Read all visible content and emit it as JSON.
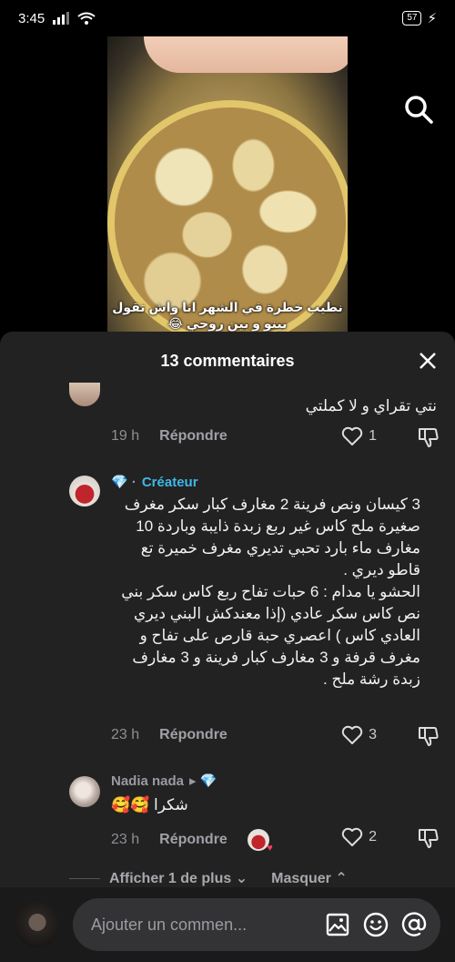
{
  "status_bar": {
    "time": "3:45",
    "battery": "57"
  },
  "video": {
    "caption": "نطيب خطرة في الشهر انا واش تقول بينو و بين روحي 😂"
  },
  "comments_sheet": {
    "title": "13 commentaires",
    "comments": [
      {
        "text": "نتي تقراي و لا كملتي",
        "time": "19 h",
        "reply_label": "Répondre",
        "likes": "1"
      },
      {
        "author_badge": "💎 ·",
        "creator_label": "Créateur",
        "text": "3 كيسان ونص فرينة 2 مغارف كبار سكر مغرف صغيرة ملح كاس غير ربع زبدة ذايبة وباردة 10 مغارف ماء بارد تحبي تديري مغرف خميرة تع قاطو ديري .\nالحشو يا مدام : 6 حبات تفاح ربع كاس سكر بني نص كاس سكر عادي (إذا معندكش البني ديري العادي كاس ) اعصري حبة قارص على تفاح و مغرف قرفة و 3 مغارف كبار فرينة و 3 مغارف زبدة رشة ملح .",
        "time": "23 h",
        "reply_label": "Répondre",
        "likes": "3"
      },
      {
        "author": "Nadia nada",
        "author_suffix": "▸ 💎",
        "text": "شكرا 🥰🥰",
        "time": "23 h",
        "reply_label": "Répondre",
        "likes": "2"
      }
    ],
    "show_more_label": "Afficher 1 de plus ⌄",
    "hide_label": "Masquer ⌃"
  },
  "input": {
    "placeholder": "Ajouter un commen..."
  },
  "colors": {
    "sheet_bg": "#222222",
    "creator": "#3fb7e8",
    "muted": "#8e8e95"
  }
}
